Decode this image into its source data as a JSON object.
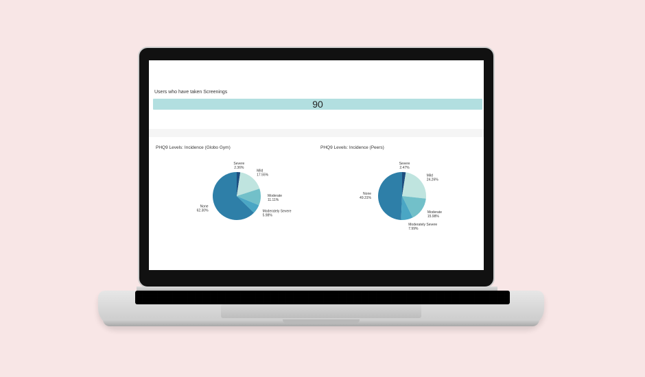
{
  "dashboard": {
    "kpi": {
      "label": "Users who have taken Screenings",
      "value": "90"
    }
  },
  "colors": {
    "kpi_bar": "#b2dfe0",
    "none": "#2e7fa8",
    "mild": "#bfe4df",
    "moderate": "#72c0c9",
    "moderately_severe": "#4aa6c4",
    "severe": "#1d4e7f"
  },
  "chart_data": [
    {
      "type": "pie",
      "title": "PHQ9 Levels: Incidence (Globo Gym)",
      "slices": [
        {
          "name": "None",
          "value": 62.3,
          "label": "62.30%"
        },
        {
          "name": "Severe",
          "value": 2.36,
          "label": "2.36%"
        },
        {
          "name": "Mild",
          "value": 17.55,
          "label": "17.55%"
        },
        {
          "name": "Moderate",
          "value": 11.11,
          "label": "11.11%"
        },
        {
          "name": "Moderately Severe",
          "value": 5.98,
          "label": "5.98%"
        }
      ]
    },
    {
      "type": "pie",
      "title": "PHQ9 Levels: Incidence (Peers)",
      "slices": [
        {
          "name": "None",
          "value": 49.31,
          "label": "49.31%"
        },
        {
          "name": "Severe",
          "value": 2.47,
          "label": "2.47%"
        },
        {
          "name": "Mild",
          "value": 24.26,
          "label": "24.26%"
        },
        {
          "name": "Moderate",
          "value": 15.98,
          "label": "15.98%"
        },
        {
          "name": "Moderately Severe",
          "value": 7.99,
          "label": "7.99%"
        }
      ]
    }
  ]
}
